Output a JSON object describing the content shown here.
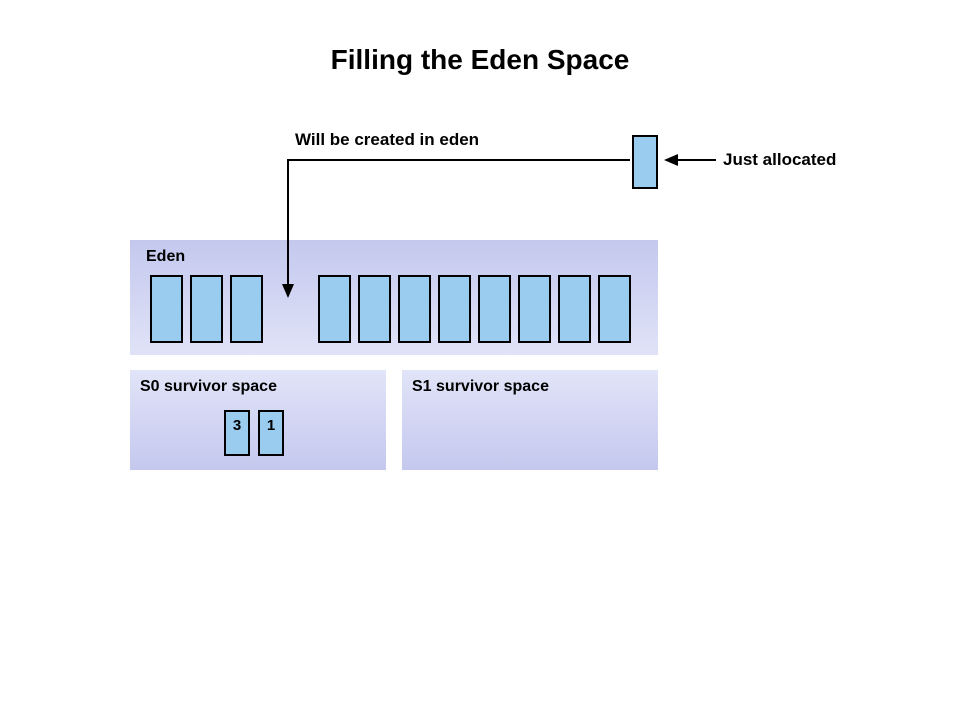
{
  "title": "Filling the Eden Space",
  "labels": {
    "created_in_eden": "Will be created in eden",
    "just_allocated": "Just allocated",
    "eden": "Eden",
    "s0": "S0 survivor space",
    "s1": "S1 survivor space"
  },
  "survivor_s0_objects": {
    "a": "3",
    "b": "1"
  },
  "colors": {
    "object_fill": "#99ccee",
    "region_grad_top": "#c4c8ee",
    "region_grad_bottom": "#e0e3f7"
  }
}
